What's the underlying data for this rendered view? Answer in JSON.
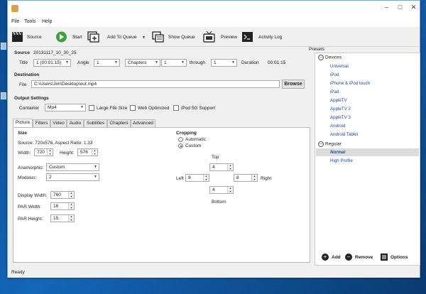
{
  "window": {
    "title": ""
  },
  "menu": [
    "File",
    "Tools",
    "Help"
  ],
  "toolbar": {
    "source": "Source",
    "start": "Start",
    "add_to_queue": "Add To Queue",
    "show_queue": "Show Queue",
    "preview": "Preview",
    "activity_log": "Activity Log"
  },
  "source": {
    "label": "Source",
    "value": "20131117_10_30_25",
    "title_label": "Title",
    "title_value": "1 (00:01:15)",
    "angle_label": "Angle",
    "angle_value": "1",
    "range_type": "Chapters",
    "from_value": "1",
    "through_label": "through",
    "to_value": "1",
    "duration_label": "Duration",
    "duration_value": "00:01:15"
  },
  "destination": {
    "label": "Destination",
    "file_label": "File",
    "file_value": "C:\\Users\\Jim\\Desktop\\out.mp4",
    "browse": "Browse"
  },
  "output": {
    "label": "Output Settings",
    "container_label": "Container",
    "container_value": "Mp4",
    "large_file": "Large File Size",
    "web_optimized": "Web Optimized",
    "ipod5g": "iPod 5G Support"
  },
  "tabs": [
    "Picture",
    "Filters",
    "Video",
    "Audio",
    "Subtitles",
    "Chapters",
    "Advanced"
  ],
  "picture": {
    "size_label": "Size",
    "source_text": "Source:  720x576, Aspect Ratio: 1.33",
    "width_label": "Width:",
    "width_value": "720",
    "height_label": "Height:",
    "height_value": "576",
    "anamorphic_label": "Anamorphic:",
    "anamorphic_value": "Custom",
    "modulus_label": "Modulus:",
    "modulus_value": "2",
    "display_width_label": "Display Width:",
    "display_width_value": "760",
    "par_width_label": "PAR Width:",
    "par_width_value": "16",
    "par_height_label": "PAR Height:",
    "par_height_value": "15",
    "cropping_label": "Cropping",
    "automatic": "Automatic",
    "custom": "Custom",
    "top_label": "Top",
    "top_value": "4",
    "left_label": "Left",
    "left_value": "8",
    "right_label": "Right",
    "right_value": "8",
    "bottom_label": "Bottom",
    "bottom_value": "4"
  },
  "presets": {
    "title": "Presets",
    "devices_label": "Devices",
    "devices": [
      "Universal",
      "iPod",
      "iPhone & iPod touch",
      "iPad",
      "AppleTV",
      "AppleTV 2",
      "AppleTV 3",
      "Android",
      "Android Tablet"
    ],
    "regular_label": "Regular",
    "regular": [
      "Normal",
      "High Profile"
    ],
    "add": "Add",
    "remove": "Remove",
    "options": "Options"
  },
  "status": {
    "text": "Ready"
  },
  "colors": {
    "link": "#1a4fa0",
    "toolbar_bg": "#f0f0f0",
    "desktop": "#0b4a8e"
  },
  "icons": [
    "film-clapper-icon",
    "play-icon",
    "add-queue-icon",
    "show-queue-icon",
    "tv-preview-icon",
    "terminal-icon"
  ]
}
